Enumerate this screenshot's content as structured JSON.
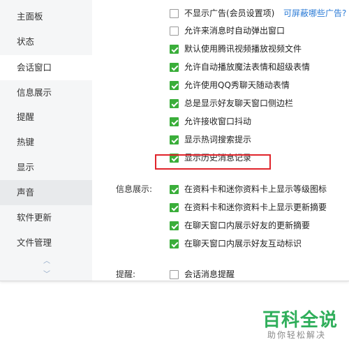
{
  "sidebar": {
    "items": [
      {
        "label": "主面板"
      },
      {
        "label": "状态"
      },
      {
        "label": "会话窗口"
      },
      {
        "label": "信息展示"
      },
      {
        "label": "提醒"
      },
      {
        "label": "热键"
      },
      {
        "label": "显示"
      },
      {
        "label": "声音"
      },
      {
        "label": "软件更新"
      },
      {
        "label": "文件管理"
      }
    ],
    "selected": "会话窗口",
    "hovered": "声音"
  },
  "session_options": [
    {
      "label": "不显示广告(会员设置项)",
      "checked": false
    },
    {
      "label": "允许来消息时自动弹出窗口",
      "checked": false
    },
    {
      "label": "默认使用腾讯视频播放视频文件",
      "checked": true
    },
    {
      "label": "允许自动播放魔法表情和超级表情",
      "checked": true
    },
    {
      "label": "允许使用QQ秀聊天随动表情",
      "checked": true
    },
    {
      "label": "总是显示好友聊天窗口侧边栏",
      "checked": true
    },
    {
      "label": "允许接收窗口抖动",
      "checked": true
    },
    {
      "label": "显示热词搜索提示",
      "checked": true
    },
    {
      "label": "显示历史消息记录",
      "checked": true
    }
  ],
  "ad_link": "可屏蔽哪些广告?",
  "info_section": {
    "label": "信息展示:",
    "options": [
      {
        "label": "在资料卡和迷你资料卡上显示等级图标",
        "checked": true
      },
      {
        "label": "在资料卡和迷你资料卡上显示更新摘要",
        "checked": true
      },
      {
        "label": "在聊天窗口内展示好友的更新摘要",
        "checked": true
      },
      {
        "label": "在聊天窗口内展示好友互动标识",
        "checked": true
      }
    ]
  },
  "remind_section": {
    "label": "提醒:",
    "options": [
      {
        "label": "会话消息提醒",
        "checked": false
      }
    ]
  },
  "colors": {
    "checkbox_checked": "#3aae3a",
    "highlight": "#e0242b",
    "link": "#2b7bd6",
    "sidebar_bg": "#f5f6f7"
  },
  "watermark": {
    "title": "百科全说",
    "subtitle": "助你轻松解决"
  }
}
